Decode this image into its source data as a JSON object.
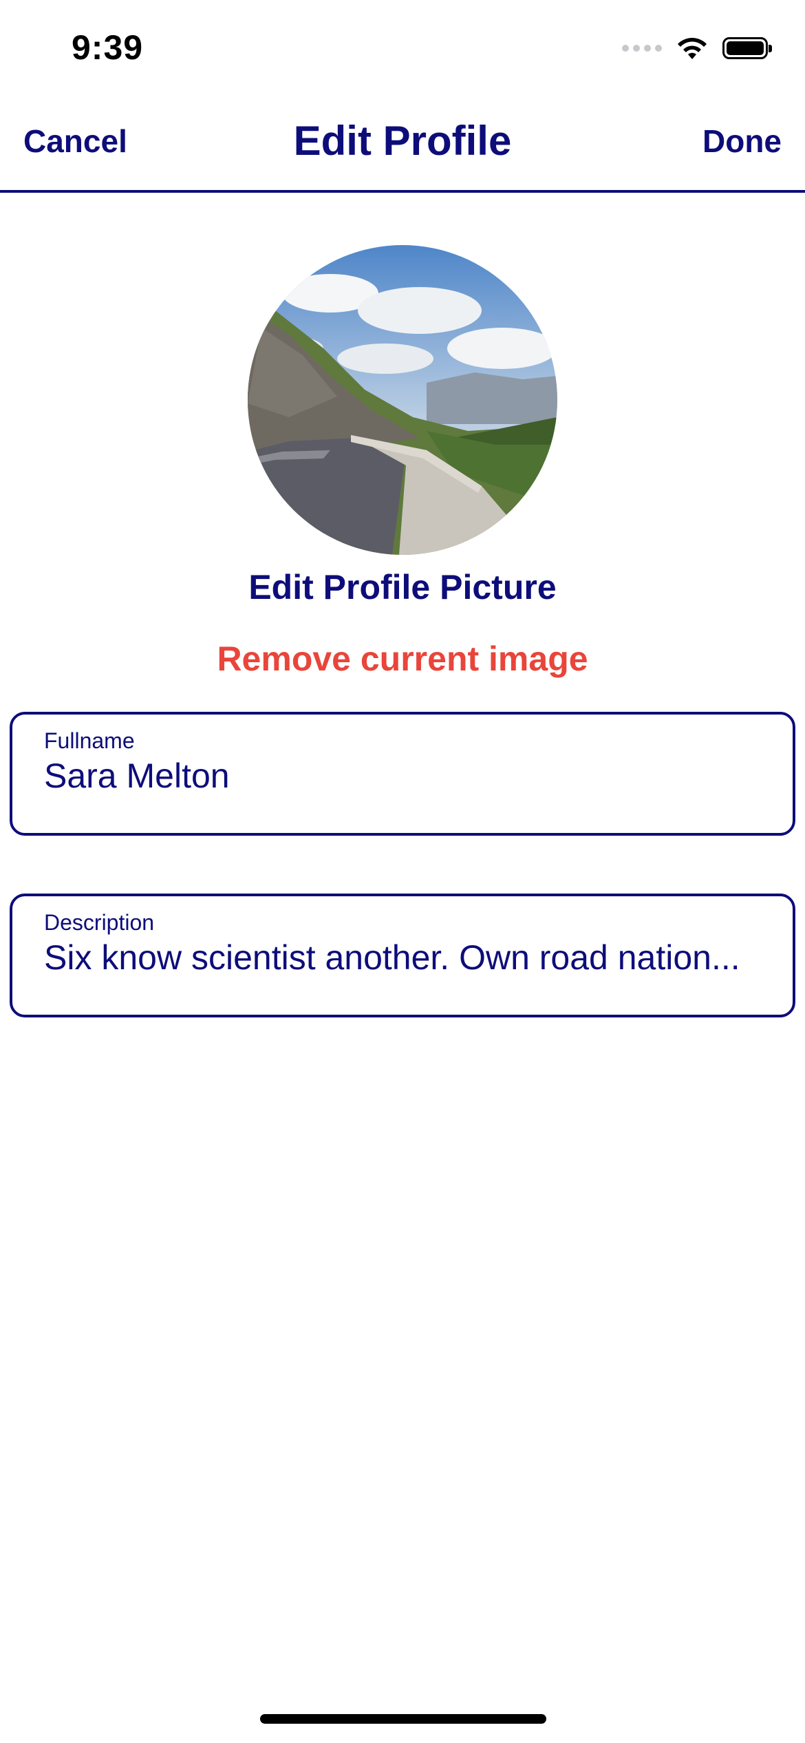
{
  "status_bar": {
    "time": "9:39",
    "icons": [
      "signal-icon",
      "wifi-icon",
      "battery-icon"
    ]
  },
  "nav": {
    "cancel_label": "Cancel",
    "title": "Edit Profile",
    "done_label": "Done"
  },
  "profile": {
    "avatar_alt": "Mountain road profile picture",
    "edit_picture_label": "Edit Profile Picture",
    "remove_image_label": "Remove current image"
  },
  "fields": {
    "fullname": {
      "label": "Fullname",
      "value": "Sara Melton"
    },
    "description": {
      "label": "Description",
      "value": "Six know scientist another. Own road nation..."
    }
  },
  "colors": {
    "accent": "#0d0d7a",
    "destructive": "#e9453a",
    "background": "#ffffff"
  }
}
